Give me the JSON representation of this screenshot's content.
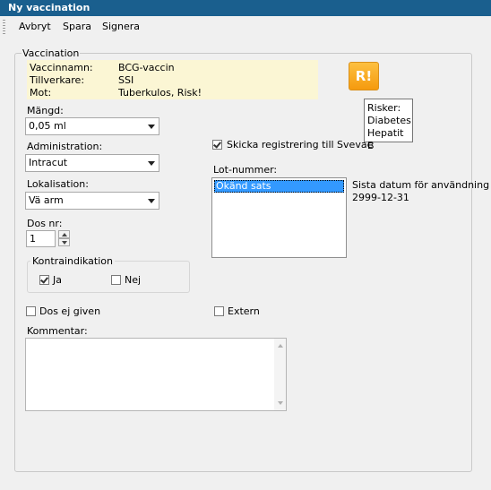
{
  "window": {
    "title": "Ny vaccination"
  },
  "toolbar": {
    "cancel": "Avbryt",
    "save": "Spara",
    "sign": "Signera"
  },
  "vaccination": {
    "group_label": "Vaccination",
    "info": [
      {
        "label": "Vaccinnamn:",
        "value": "BCG-vaccin"
      },
      {
        "label": "Tillverkare:",
        "value": "SSI"
      },
      {
        "label": "Mot:",
        "value": "Tuberkulos, Risk!"
      }
    ]
  },
  "risk": {
    "button_label": "R!",
    "tooltip": [
      "Risker:",
      "Diabetes",
      "Hepatit B"
    ]
  },
  "dose_amount": {
    "label": "Mängd:",
    "value": "0,05 ml"
  },
  "administration": {
    "label": "Administration:",
    "value": "Intracut"
  },
  "location": {
    "label": "Lokalisation:",
    "value": "Vä arm"
  },
  "dose_number": {
    "label": "Dos nr:",
    "value": "1"
  },
  "contraindication": {
    "label": "Kontraindikation",
    "yes": {
      "label": "Ja",
      "checked": true
    },
    "no": {
      "label": "Nej",
      "checked": false
    }
  },
  "send_to_svevac": {
    "label": "Skicka registrering till Svevac",
    "checked": true
  },
  "lot": {
    "label": "Lot-nummer:",
    "items": [
      "Okänd sats"
    ],
    "expiry_label": "Sista datum för användning",
    "expiry_value": "2999-12-31"
  },
  "dose_not_given": {
    "label": "Dos ej given",
    "checked": false
  },
  "external": {
    "label": "Extern",
    "checked": false
  },
  "comment": {
    "label": "Kommentar:",
    "value": ""
  },
  "colors": {
    "titlebar": "#1a5f8e",
    "info_bg": "#fbf6d4",
    "risk_orange": "#f7a51c",
    "selection": "#3399ff"
  }
}
